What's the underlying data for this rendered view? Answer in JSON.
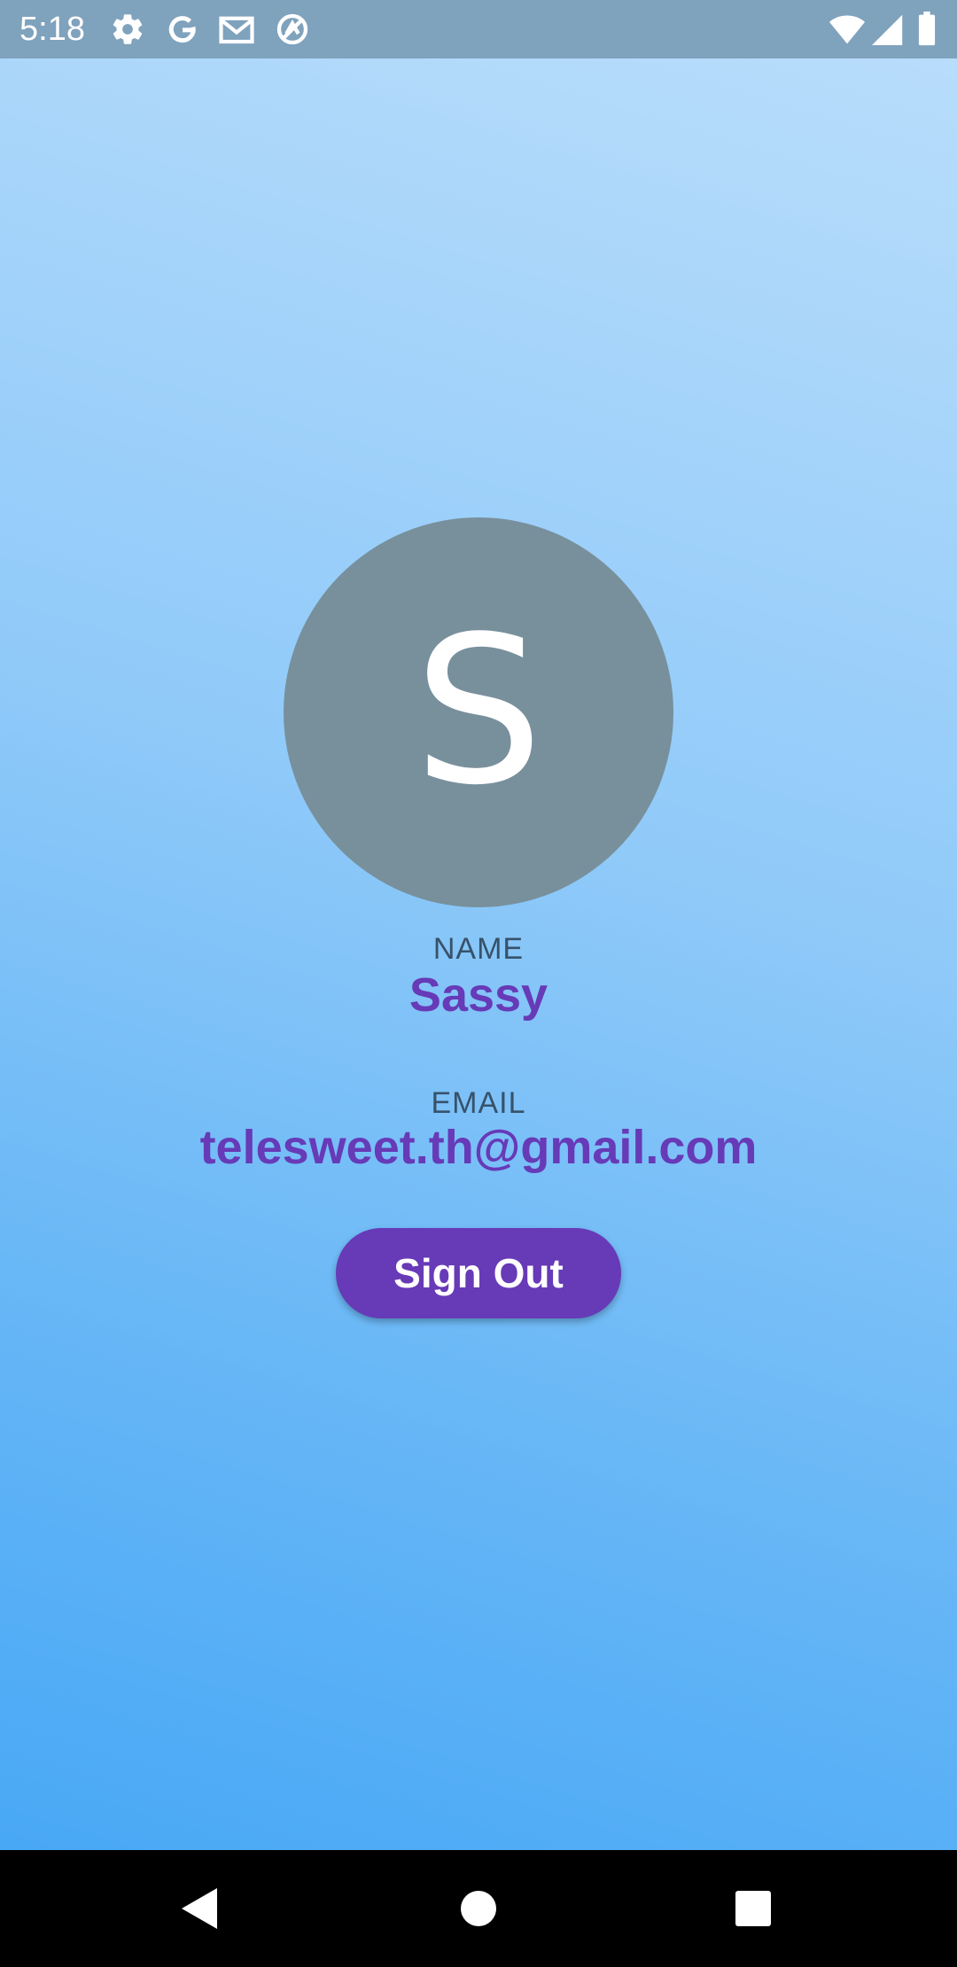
{
  "status_bar": {
    "time": "5:18",
    "left_icons": [
      "gear-icon",
      "google-icon",
      "gmail-icon",
      "sync-icon"
    ],
    "right_icons": [
      "wifi-icon",
      "cell-signal-icon",
      "battery-icon"
    ]
  },
  "profile": {
    "avatar_initial": "S",
    "avatar_color": "#78909c",
    "name_label": "NAME",
    "name": "Sassy",
    "email_label": "EMAIL",
    "email": "telesweet.th@gmail.com"
  },
  "actions": {
    "sign_out_label": "Sign Out"
  },
  "nav_bar": {
    "buttons": [
      "back-icon",
      "home-icon",
      "recents-icon"
    ]
  },
  "colors": {
    "accent": "#673ab7",
    "gradient_top": "#bbdefb",
    "gradient_bottom": "#42a5f5"
  }
}
